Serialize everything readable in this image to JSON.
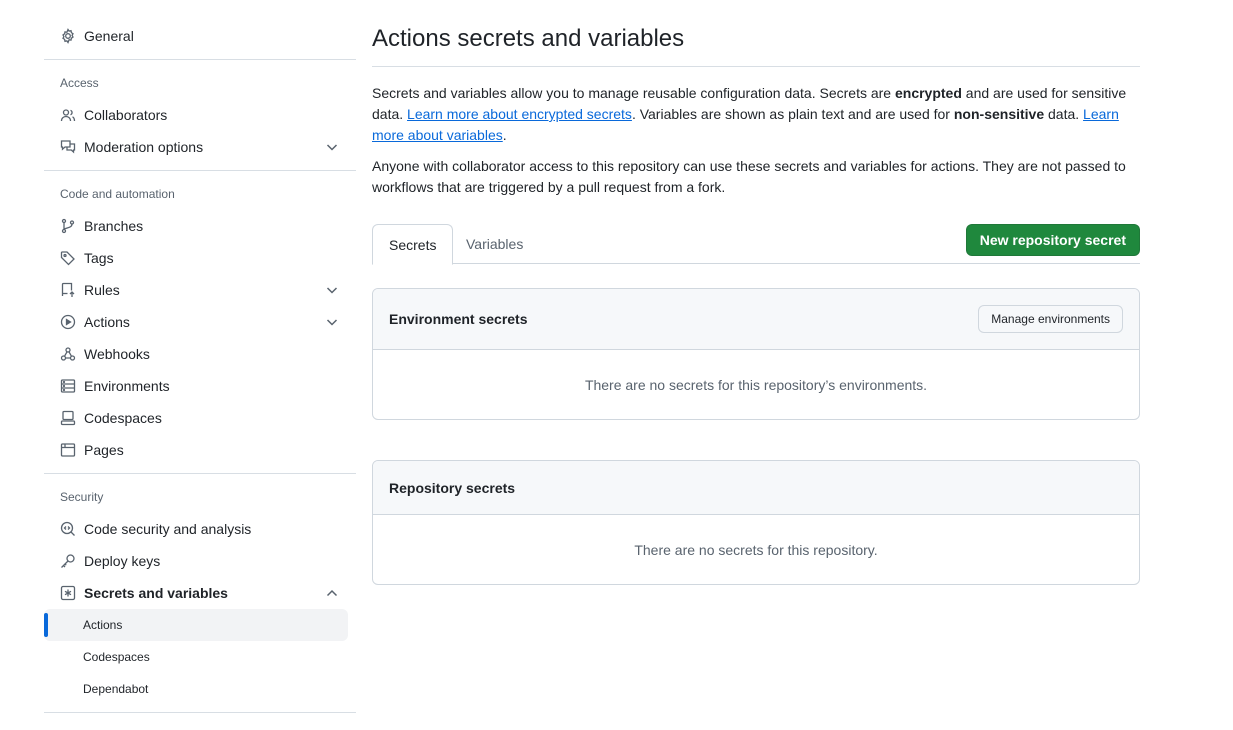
{
  "sidebar": {
    "general": "General",
    "access": {
      "title": "Access",
      "collaborators": "Collaborators",
      "moderation": "Moderation options"
    },
    "code_automation": {
      "title": "Code and automation",
      "branches": "Branches",
      "tags": "Tags",
      "rules": "Rules",
      "actions": "Actions",
      "webhooks": "Webhooks",
      "environments": "Environments",
      "codespaces": "Codespaces",
      "pages": "Pages"
    },
    "security": {
      "title": "Security",
      "code_security": "Code security and analysis",
      "deploy_keys": "Deploy keys",
      "secrets_vars": "Secrets and variables",
      "sub": {
        "actions": "Actions",
        "codespaces": "Codespaces",
        "dependabot": "Dependabot"
      }
    }
  },
  "main": {
    "title": "Actions secrets and variables",
    "intro": {
      "p1_a": "Secrets and variables allow you to manage reusable configuration data. Secrets are ",
      "p1_b": "encrypted",
      "p1_c": " and are used for sensitive data. ",
      "p1_link1": "Learn more about encrypted secrets",
      "p1_d": ". Variables are shown as plain text and are used for ",
      "p1_e": "non-sensitive",
      "p1_f": " data. ",
      "p1_link2": "Learn more about variables",
      "p1_g": ".",
      "p2": "Anyone with collaborator access to this repository can use these secrets and variables for actions. They are not passed to workflows that are triggered by a pull request from a fork."
    },
    "tabs": {
      "secrets": "Secrets",
      "variables": "Variables"
    },
    "new_secret_button": "New repository secret",
    "env_secrets": {
      "title": "Environment secrets",
      "manage_button": "Manage environments",
      "empty": "There are no secrets for this repository’s environments."
    },
    "repo_secrets": {
      "title": "Repository secrets",
      "empty": "There are no secrets for this repository."
    }
  },
  "colors": {
    "primary_button": "#1f883d",
    "link": "#0969da",
    "active_indicator": "#0969da"
  }
}
